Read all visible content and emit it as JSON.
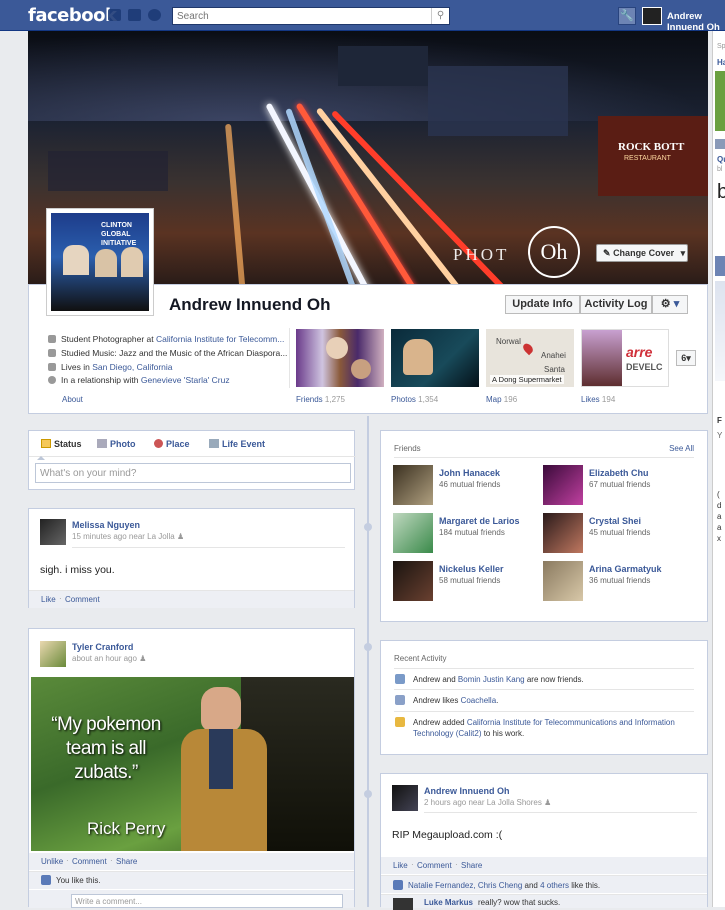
{
  "topbar": {
    "logo": "facebook",
    "search_placeholder": "Search",
    "user_name": "Andrew Innuend Oh"
  },
  "profile": {
    "name": "Andrew Innuend Oh",
    "change_cover": "Change Cover",
    "update_info": "Update Info",
    "activity_log": "Activity Log",
    "about_link": "About",
    "more_count": "6",
    "info": [
      {
        "pre": "Student Photographer at ",
        "link": "California Institute for Telecomm...",
        "post": ""
      },
      {
        "pre": "Studied Music: Jazz and the Music of the African Diaspora...",
        "link": "",
        "post": ""
      },
      {
        "pre": "Lives in ",
        "link": "San Diego, California",
        "post": ""
      },
      {
        "pre": "In a relationship with ",
        "link": "Genevieve 'Starla' Cruz",
        "post": ""
      }
    ],
    "tiles": [
      {
        "label": "Friends",
        "count": "1,275"
      },
      {
        "label": "Photos",
        "count": "1,354"
      },
      {
        "label": "Map",
        "count": "196"
      },
      {
        "label": "Likes",
        "count": "194"
      }
    ],
    "map_labels": [
      "Norwal",
      "Anahei",
      "Santa",
      "A Dong Supermarket"
    ],
    "likes_logo": "arre",
    "likes_sub": "DEVELC",
    "cover_watermark": "PHOT",
    "cover_logo_text": "Oh",
    "cover_sign": "ROCK BOTT",
    "cover_sign_sub": "RESTAURANT",
    "profile_pic_text": "CLINTON GLOBAL INITIATIVE"
  },
  "composer": {
    "tabs": [
      "Status",
      "Photo",
      "Place",
      "Life Event"
    ],
    "placeholder": "What's on your mind?"
  },
  "posts_left": [
    {
      "author": "Melissa Nguyen",
      "meta": "15 minutes ago near La Jolla",
      "text": "sigh. i miss you.",
      "actions": [
        "Like",
        "Comment"
      ]
    },
    {
      "author": "Tyler Cranford",
      "meta": "about an hour ago",
      "image_quote": "“My pokemon team is all zubats.”",
      "image_caption": "Rick Perry",
      "actions": [
        "Unlike",
        "Comment",
        "Share"
      ],
      "likes": "You like this.",
      "comment_placeholder": "Write a comment..."
    }
  ],
  "friends_box": {
    "title": "Friends",
    "see_all": "See All",
    "friends": [
      {
        "name": "John Hanacek",
        "mutual": "46 mutual friends"
      },
      {
        "name": "Elizabeth Chu",
        "mutual": "67 mutual friends"
      },
      {
        "name": "Margaret de Larios",
        "mutual": "184 mutual friends"
      },
      {
        "name": "Crystal Shei",
        "mutual": "45 mutual friends"
      },
      {
        "name": "Nickelus Keller",
        "mutual": "58 mutual friends"
      },
      {
        "name": "Arina Garmatyuk",
        "mutual": "36 mutual friends"
      }
    ]
  },
  "recent_activity": {
    "title": "Recent Activity",
    "items": [
      {
        "pre": "Andrew and ",
        "link": "Bomin Justin Kang",
        "post": " are now friends."
      },
      {
        "pre": "Andrew likes ",
        "link": "Coachella",
        "post": "."
      },
      {
        "pre": "Andrew added ",
        "link": "California Institute for Telecommunications and Information Technology (Calit2)",
        "post": " to his work."
      }
    ]
  },
  "post_right": {
    "author": "Andrew Innuend Oh",
    "meta": "2 hours ago near La Jolla Shores",
    "text": "RIP Megaupload.com :(",
    "actions": [
      "Like",
      "Comment",
      "Share"
    ],
    "likes_pre": "",
    "likes_names": "Natalie Fernandez, Chris Cheng",
    "likes_mid": " and ",
    "likes_others": "4 others",
    "likes_post": " like this.",
    "comment_author": "Luke Markus",
    "comment_text": "really? wow that sucks."
  },
  "sidebar": {
    "fragments": [
      "Sp",
      "Ha",
      "Qu",
      "bl",
      "b",
      "F",
      "Y",
      "F",
      "Y",
      "(",
      "d",
      "a",
      "a",
      "x"
    ]
  },
  "colors": {
    "brand": "#3b5998",
    "background": "#e9ebee"
  }
}
